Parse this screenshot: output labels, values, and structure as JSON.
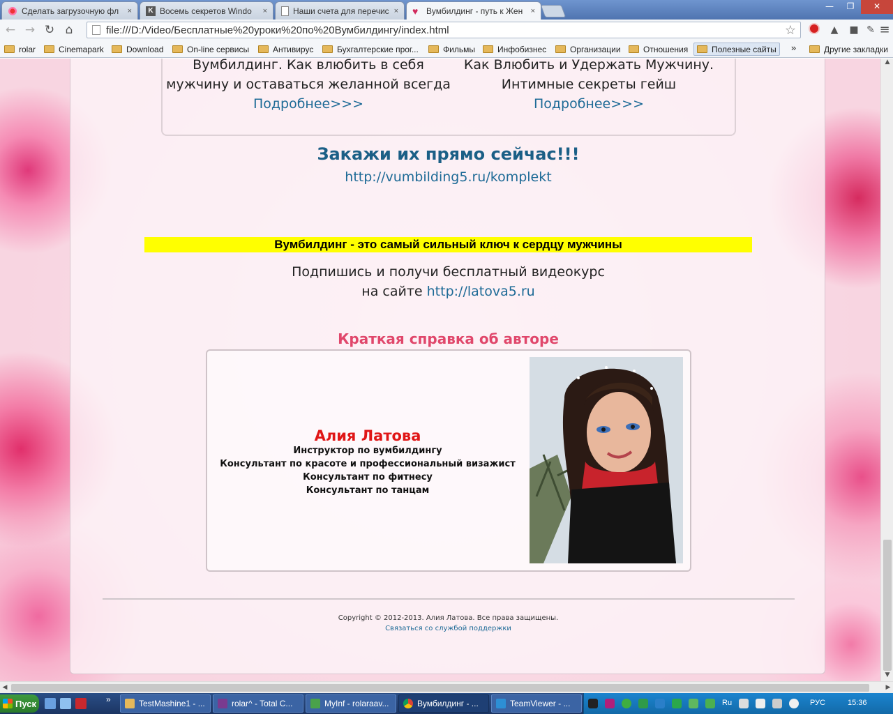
{
  "browser": {
    "tabs": [
      {
        "title": "Сделать загрузочную фл",
        "icon": "flower-favicon"
      },
      {
        "title": "Восемь секретов Windo",
        "icon": "k-favicon"
      },
      {
        "title": "Наши счета для перечис",
        "icon": "document-favicon"
      },
      {
        "title": "Вумбилдинг - путь к Жен",
        "icon": "heart-favicon",
        "active": true
      }
    ],
    "close_glyph": "×",
    "window_controls": {
      "minimize": "—",
      "restore": "❐",
      "close": "✕"
    },
    "toolbar": {
      "back": "←",
      "forward": "→",
      "reload": "↻",
      "home": "⌂",
      "url": "file:///D:/Video/Бесплатные%20уроки%20по%20Вумбилдингу/index.html",
      "star": "☆",
      "menu": "≡"
    },
    "bookmarks": [
      {
        "label": "rolar"
      },
      {
        "label": "Cinemapark"
      },
      {
        "label": "Download"
      },
      {
        "label": "On-line сервисы"
      },
      {
        "label": "Антивирус"
      },
      {
        "label": "Бухгалтерские прог..."
      },
      {
        "label": "Фильмы"
      },
      {
        "label": "Инфобизнес"
      },
      {
        "label": "Организации"
      },
      {
        "label": "Отношения"
      },
      {
        "label": "Полезные сайты"
      }
    ],
    "bookmarks_overflow": "»",
    "other_bookmarks": "Другие закладки"
  },
  "page": {
    "books": [
      {
        "line1": "Вумбилдинг. Как влюбить в себя",
        "line2": "мужчину и оставаться желанной всегда",
        "more": "Подробнее>>>"
      },
      {
        "line1": "Как Влюбить и Удержать Мужчину.",
        "line2": "Интимные секреты гейш",
        "more": "Подробнее>>>"
      }
    ],
    "order_title": "Закажи их прямо сейчас!!!",
    "order_link": "http://vumbilding5.ru/komplekt",
    "banner": "Вумбилдинг - это самый сильный ключ к сердцу мужчины",
    "subscribe_line1": "Подпишись и получи бесплатный видеокурс",
    "subscribe_prefix": "на сайте",
    "subscribe_link": "http://latova5.ru",
    "author_heading": "Краткая справка об авторе",
    "author": {
      "name": "Алия Латова",
      "roles": [
        "Инструктор по вумбилдингу",
        "Консультант по красоте и профессиональный визажист",
        "Консультант по фитнесу",
        "Консультант по танцам"
      ]
    },
    "copyright": "Copyright © 2012-2013. Алия Латова. Все права защищены.",
    "support_link": "Связаться со службой поддержки"
  },
  "taskbar": {
    "start": "Пуск",
    "tasks": [
      {
        "label": "TestMashine1 - ...",
        "icon": "folder-icon"
      },
      {
        "label": "rolar^ - Total C...",
        "icon": "total-commander-icon"
      },
      {
        "label": "MyInf - rolaraav...",
        "icon": "myinf-icon"
      },
      {
        "label": "Вумбилдинг - ...",
        "icon": "chrome-icon",
        "active": true
      },
      {
        "label": "TeamViewer - ...",
        "icon": "teamviewer-icon"
      }
    ],
    "tray_lang_indicator": "Ru",
    "language": "РУС",
    "clock": "15:36"
  },
  "colors": {
    "link": "#1d6a96",
    "banner_bg": "#ffff00",
    "author_heading": "#e0476b",
    "author_name": "#e01616",
    "taskbar": "#2a4e86"
  }
}
